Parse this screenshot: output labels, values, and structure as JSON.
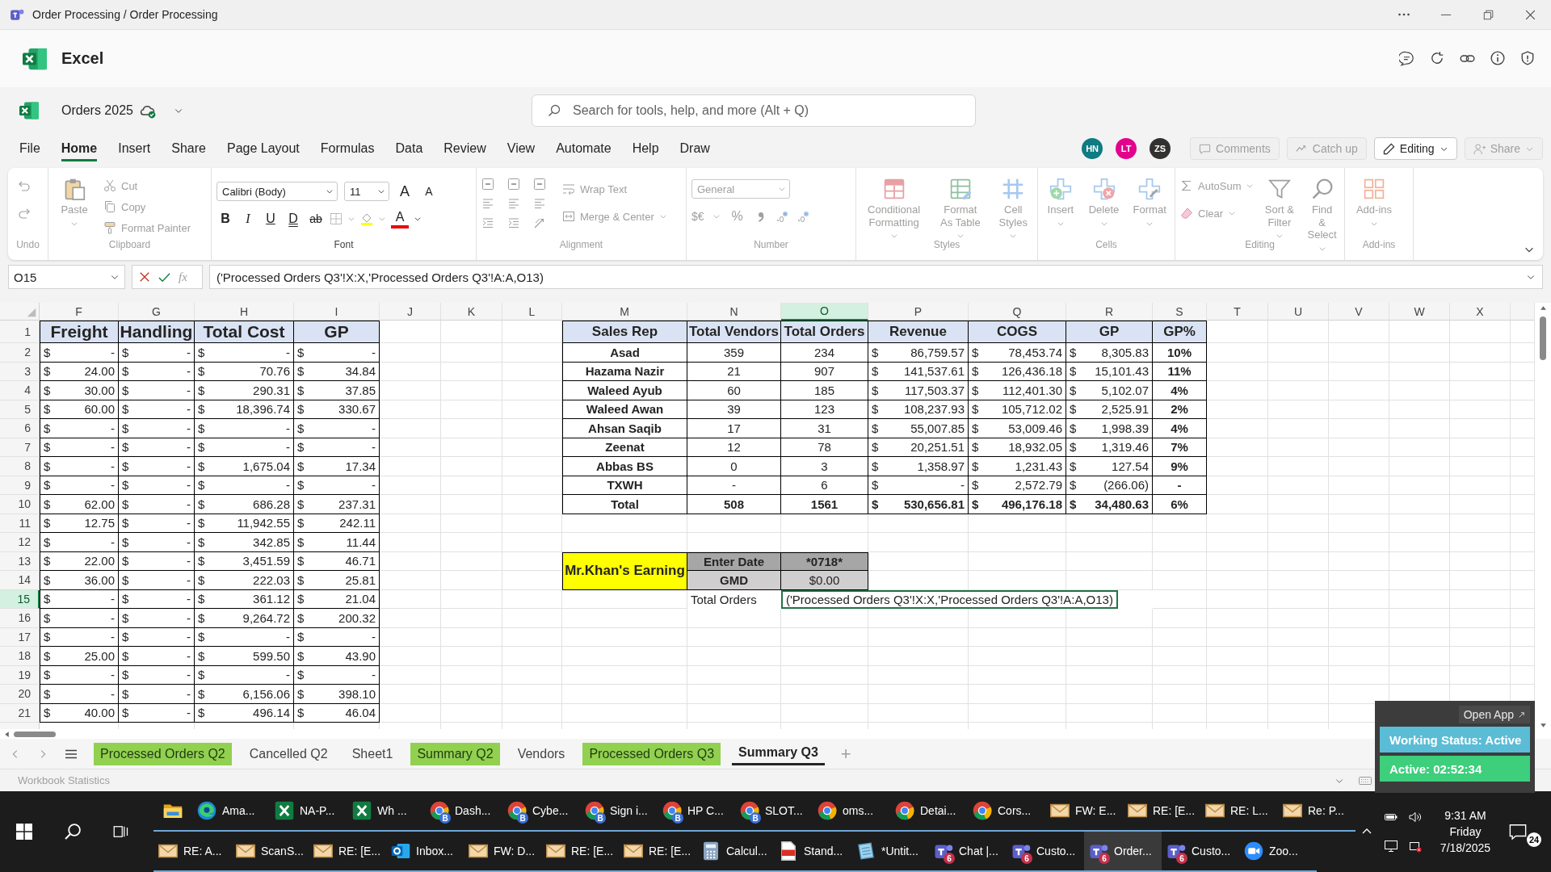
{
  "title_bar": {
    "title": "Order Processing / Order Processing"
  },
  "app": {
    "name": "Excel"
  },
  "document": {
    "name": "Orders 2025"
  },
  "search": {
    "placeholder": "Search for tools, help, and more (Alt + Q)"
  },
  "menu_tabs": [
    {
      "label": "File",
      "selected": false
    },
    {
      "label": "Home",
      "selected": true
    },
    {
      "label": "Insert",
      "selected": false
    },
    {
      "label": "Share",
      "selected": false
    },
    {
      "label": "Page Layout",
      "selected": false
    },
    {
      "label": "Formulas",
      "selected": false
    },
    {
      "label": "Data",
      "selected": false
    },
    {
      "label": "Review",
      "selected": false
    },
    {
      "label": "View",
      "selected": false
    },
    {
      "label": "Automate",
      "selected": false
    },
    {
      "label": "Help",
      "selected": false
    },
    {
      "label": "Draw",
      "selected": false
    }
  ],
  "collaborators": [
    {
      "initials": "HN",
      "color": "#0f7b83"
    },
    {
      "initials": "LT",
      "color": "#e3008c"
    },
    {
      "initials": "ZS",
      "color": "#323130"
    }
  ],
  "header_buttons": [
    {
      "label": "Comments",
      "kind": "comments",
      "disabled": true
    },
    {
      "label": "Catch up",
      "kind": "catchup",
      "disabled": true
    },
    {
      "label": "Editing",
      "kind": "editing",
      "disabled": false
    },
    {
      "label": "Share",
      "kind": "share",
      "disabled": true
    }
  ],
  "ribbon": {
    "groups": [
      {
        "kind": "undo",
        "label": "Undo",
        "disabled": true
      },
      {
        "kind": "clipboard",
        "label": "Clipboard",
        "disabled": true,
        "items": [
          {
            "label": "Paste"
          },
          {
            "label": "Cut"
          },
          {
            "label": "Copy"
          },
          {
            "label": "Format Painter"
          }
        ]
      },
      {
        "kind": "font",
        "label": "Font",
        "disabled": false,
        "items": [
          {
            "label": "Calibri (Body)"
          },
          {
            "label": "11"
          },
          {
            "label": "A"
          },
          {
            "label": "A"
          },
          {
            "label": "B"
          },
          {
            "label": "I"
          },
          {
            "label": "U"
          },
          {
            "label": "D"
          },
          {
            "label": "ab"
          },
          {
            "label": "A"
          }
        ]
      },
      {
        "kind": "alignment",
        "label": "Alignment",
        "disabled": true,
        "items": [
          {
            "label": "Wrap Text"
          },
          {
            "label": "Merge & Center"
          }
        ]
      },
      {
        "kind": "number",
        "label": "Number",
        "disabled": true,
        "items": [
          {
            "label": "General"
          },
          {
            "label": "$€"
          },
          {
            "label": "%"
          }
        ]
      },
      {
        "kind": "styles",
        "label": "Styles",
        "disabled": true,
        "items": [
          {
            "label": "Conditional Formatting"
          },
          {
            "label": "Format As Table"
          },
          {
            "label": "Cell Styles"
          }
        ]
      },
      {
        "kind": "cells",
        "label": "Cells",
        "disabled": true,
        "items": [
          {
            "label": "Insert"
          },
          {
            "label": "Delete"
          },
          {
            "label": "Format"
          }
        ]
      },
      {
        "kind": "editing",
        "label": "Editing",
        "disabled": true,
        "items": [
          {
            "label": "AutoSum"
          },
          {
            "label": "Clear"
          },
          {
            "label": "Sort & Filter"
          },
          {
            "label": "Find & Select"
          }
        ]
      },
      {
        "kind": "addins",
        "label": "Add-ins",
        "disabled": true,
        "items": [
          {
            "label": "Add-ins"
          }
        ]
      }
    ]
  },
  "formula_bar": {
    "name_box": "O15",
    "function_label": "fx",
    "formula": "('Processed Orders Q3'!X:X,'Processed Orders Q3'!A:A,O13)"
  },
  "sheet": {
    "columns": [
      {
        "label": "F",
        "selected": false
      },
      {
        "label": "G",
        "selected": false
      },
      {
        "label": "H",
        "selected": false
      },
      {
        "label": "I",
        "selected": false
      },
      {
        "label": "J",
        "selected": false
      },
      {
        "label": "K",
        "selected": false
      },
      {
        "label": "L",
        "selected": false
      },
      {
        "label": "M",
        "selected": false
      },
      {
        "label": "N",
        "selected": false
      },
      {
        "label": "O",
        "selected": true
      },
      {
        "label": "P",
        "selected": false
      },
      {
        "label": "Q",
        "selected": false
      },
      {
        "label": "R",
        "selected": false
      },
      {
        "label": "S",
        "selected": false
      },
      {
        "label": "T",
        "selected": false
      },
      {
        "label": "U",
        "selected": false
      },
      {
        "label": "V",
        "selected": false
      },
      {
        "label": "W",
        "selected": false
      },
      {
        "label": "X",
        "selected": false
      }
    ],
    "rows": [
      {
        "number": "1",
        "selected": false
      },
      {
        "number": "2",
        "selected": false
      },
      {
        "number": "3",
        "selected": false
      },
      {
        "number": "4",
        "selected": false
      },
      {
        "number": "5",
        "selected": false
      },
      {
        "number": "6",
        "selected": false
      },
      {
        "number": "7",
        "selected": false
      },
      {
        "number": "8",
        "selected": false
      },
      {
        "number": "9",
        "selected": false
      },
      {
        "number": "10",
        "selected": false
      },
      {
        "number": "11",
        "selected": false
      },
      {
        "number": "12",
        "selected": false
      },
      {
        "number": "13",
        "selected": false
      },
      {
        "number": "14",
        "selected": false
      },
      {
        "number": "15",
        "selected": true
      },
      {
        "number": "16",
        "selected": false
      },
      {
        "number": "17",
        "selected": false
      },
      {
        "number": "18",
        "selected": false
      },
      {
        "number": "19",
        "selected": false
      },
      {
        "number": "20",
        "selected": false
      },
      {
        "number": "21",
        "selected": false
      }
    ],
    "left_table": {
      "headers": [
        "Freight",
        "Handling",
        "Total Cost",
        "GP"
      ],
      "rows": [
        [
          [
            "$",
            "-"
          ],
          [
            "$",
            "-"
          ],
          [
            "$",
            "-"
          ],
          [
            "$",
            "-"
          ]
        ],
        [
          [
            "$",
            "24.00"
          ],
          [
            "$",
            "-"
          ],
          [
            "$",
            "70.76"
          ],
          [
            "$",
            "34.84"
          ]
        ],
        [
          [
            "$",
            "30.00"
          ],
          [
            "$",
            "-"
          ],
          [
            "$",
            "290.31"
          ],
          [
            "$",
            "37.85"
          ]
        ],
        [
          [
            "$",
            "60.00"
          ],
          [
            "$",
            "-"
          ],
          [
            "$",
            "18,396.74"
          ],
          [
            "$",
            "330.67"
          ]
        ],
        [
          [
            "$",
            "-"
          ],
          [
            "$",
            "-"
          ],
          [
            "$",
            "-"
          ],
          [
            "$",
            "-"
          ]
        ],
        [
          [
            "$",
            "-"
          ],
          [
            "$",
            "-"
          ],
          [
            "$",
            "-"
          ],
          [
            "$",
            "-"
          ]
        ],
        [
          [
            "$",
            "-"
          ],
          [
            "$",
            "-"
          ],
          [
            "$",
            "1,675.04"
          ],
          [
            "$",
            "17.34"
          ]
        ],
        [
          [
            "$",
            "-"
          ],
          [
            "$",
            "-"
          ],
          [
            "$",
            "-"
          ],
          [
            "$",
            "-"
          ]
        ],
        [
          [
            "$",
            "62.00"
          ],
          [
            "$",
            "-"
          ],
          [
            "$",
            "686.28"
          ],
          [
            "$",
            "237.31"
          ]
        ],
        [
          [
            "$",
            "12.75"
          ],
          [
            "$",
            "-"
          ],
          [
            "$",
            "11,942.55"
          ],
          [
            "$",
            "242.11"
          ]
        ],
        [
          [
            "$",
            "-"
          ],
          [
            "$",
            "-"
          ],
          [
            "$",
            "342.85"
          ],
          [
            "$",
            "11.44"
          ]
        ],
        [
          [
            "$",
            "22.00"
          ],
          [
            "$",
            "-"
          ],
          [
            "$",
            "3,451.59"
          ],
          [
            "$",
            "46.71"
          ]
        ],
        [
          [
            "$",
            "36.00"
          ],
          [
            "$",
            "-"
          ],
          [
            "$",
            "222.03"
          ],
          [
            "$",
            "25.81"
          ]
        ],
        [
          [
            "$",
            "-"
          ],
          [
            "$",
            "-"
          ],
          [
            "$",
            "361.12"
          ],
          [
            "$",
            "21.04"
          ]
        ],
        [
          [
            "$",
            "-"
          ],
          [
            "$",
            "-"
          ],
          [
            "$",
            "9,264.72"
          ],
          [
            "$",
            "200.32"
          ]
        ],
        [
          [
            "$",
            "-"
          ],
          [
            "$",
            "-"
          ],
          [
            "$",
            "-"
          ],
          [
            "$",
            "-"
          ]
        ],
        [
          [
            "$",
            "25.00"
          ],
          [
            "$",
            "-"
          ],
          [
            "$",
            "599.50"
          ],
          [
            "$",
            "43.90"
          ]
        ],
        [
          [
            "$",
            "-"
          ],
          [
            "$",
            "-"
          ],
          [
            "$",
            "-"
          ],
          [
            "$",
            "-"
          ]
        ],
        [
          [
            "$",
            "-"
          ],
          [
            "$",
            "-"
          ],
          [
            "$",
            "6,156.06"
          ],
          [
            "$",
            "398.10"
          ]
        ],
        [
          [
            "$",
            "40.00"
          ],
          [
            "$",
            "-"
          ],
          [
            "$",
            "496.14"
          ],
          [
            "$",
            "46.04"
          ]
        ]
      ]
    },
    "summary_table": {
      "headers": [
        "Sales Rep",
        "Total Vendors",
        "Total Orders",
        "Revenue",
        "COGS",
        "GP",
        "GP%"
      ],
      "rows": [
        {
          "kind": "rep",
          "sales_rep": "Asad",
          "total_vendors": "359",
          "total_orders": "234",
          "revenue": [
            "$",
            "86,759.57"
          ],
          "cogs": [
            "$",
            "78,453.74"
          ],
          "gp": [
            "$",
            "8,305.83"
          ],
          "gp_pct": "10%"
        },
        {
          "kind": "rep",
          "sales_rep": "Hazama Nazir",
          "total_vendors": "21",
          "total_orders": "907",
          "revenue": [
            "$",
            "141,537.61"
          ],
          "cogs": [
            "$",
            "126,436.18"
          ],
          "gp": [
            "$",
            "15,101.43"
          ],
          "gp_pct": "11%"
        },
        {
          "kind": "rep",
          "sales_rep": "Waleed Ayub",
          "total_vendors": "60",
          "total_orders": "185",
          "revenue": [
            "$",
            "117,503.37"
          ],
          "cogs": [
            "$",
            "112,401.30"
          ],
          "gp": [
            "$",
            "5,102.07"
          ],
          "gp_pct": "4%"
        },
        {
          "kind": "rep",
          "sales_rep": "Waleed Awan",
          "total_vendors": "39",
          "total_orders": "123",
          "revenue": [
            "$",
            "108,237.93"
          ],
          "cogs": [
            "$",
            "105,712.02"
          ],
          "gp": [
            "$",
            "2,525.91"
          ],
          "gp_pct": "2%"
        },
        {
          "kind": "rep",
          "sales_rep": "Ahsan Saqib",
          "total_vendors": "17",
          "total_orders": "31",
          "revenue": [
            "$",
            "55,007.85"
          ],
          "cogs": [
            "$",
            "53,009.46"
          ],
          "gp": [
            "$",
            "1,998.39"
          ],
          "gp_pct": "4%"
        },
        {
          "kind": "rep",
          "sales_rep": "Zeenat",
          "total_vendors": "12",
          "total_orders": "78",
          "revenue": [
            "$",
            "20,251.51"
          ],
          "cogs": [
            "$",
            "18,932.05"
          ],
          "gp": [
            "$",
            "1,319.46"
          ],
          "gp_pct": "7%"
        },
        {
          "kind": "rep",
          "sales_rep": "Abbas BS",
          "total_vendors": "0",
          "total_orders": "3",
          "revenue": [
            "$",
            "1,358.97"
          ],
          "cogs": [
            "$",
            "1,231.43"
          ],
          "gp": [
            "$",
            "127.54"
          ],
          "gp_pct": "9%"
        },
        {
          "kind": "rep",
          "sales_rep": "TXWH",
          "total_vendors": "-",
          "total_orders": "6",
          "revenue": [
            "$",
            "-"
          ],
          "cogs": [
            "$",
            "2,572.79"
          ],
          "gp": [
            "$",
            "(266.06)"
          ],
          "gp_pct": "-"
        },
        {
          "kind": "total",
          "sales_rep": "Total",
          "total_vendors": "508",
          "total_orders": "1561",
          "revenue": [
            "$",
            "530,656.81"
          ],
          "cogs": [
            "$",
            "496,176.18"
          ],
          "gp": [
            "$",
            "34,480.63"
          ],
          "gp_pct": "6%"
        }
      ]
    },
    "earnings": {
      "title": "Mr.Khan's Earning",
      "rows": [
        {
          "label": "Enter Date",
          "value": "*0718*"
        },
        {
          "label": "GMD",
          "value": "$0.00"
        }
      ]
    },
    "total_orders": {
      "label": "Total Orders",
      "formula": "('Processed Orders Q3'!X:X,'Processed Orders Q3'!A:A,O13)"
    }
  },
  "sheet_tabs": [
    {
      "label": "Processed Orders Q2",
      "color": "#92d050",
      "selected": false
    },
    {
      "label": "Cancelled Q2",
      "selected": false
    },
    {
      "label": "Sheet1",
      "selected": false
    },
    {
      "label": "Summary Q2",
      "color": "#92d050",
      "selected": false
    },
    {
      "label": "Vendors",
      "selected": false
    },
    {
      "label": "Processed Orders Q3",
      "color": "#92d050",
      "selected": false
    },
    {
      "label": "Summary Q3",
      "selected": true
    }
  ],
  "add_sheet": "+",
  "status_bar": {
    "label": "Workbook Statistics"
  },
  "widget": {
    "open_app": "Open App",
    "status": "Working Status: Active",
    "timer": "Active: 02:52:34"
  },
  "taskbar": {
    "rows": [
      [
        {
          "kind": "folder",
          "selected": false
        },
        {
          "kind": "edge",
          "label": "Ama...",
          "selected": false
        },
        {
          "kind": "excel",
          "label": "NA-P...",
          "selected": false
        },
        {
          "kind": "excel",
          "label": "Wh ...",
          "selected": false
        },
        {
          "kind": "chrome",
          "label": "Dash...",
          "badge": "B",
          "selected": false
        },
        {
          "kind": "chrome",
          "label": "Cybe...",
          "badge": "B",
          "selected": false
        },
        {
          "kind": "chrome",
          "label": "Sign i...",
          "badge": "B",
          "selected": false
        },
        {
          "kind": "chrome",
          "label": "HP C...",
          "badge": "B",
          "selected": false
        },
        {
          "kind": "chrome",
          "label": "SLOT...",
          "badge": "B",
          "selected": false
        },
        {
          "kind": "chrome",
          "label": "oms...",
          "selected": false
        },
        {
          "kind": "chrome",
          "label": "Detai...",
          "selected": false
        },
        {
          "kind": "chrome",
          "label": "Cors...",
          "selected": false
        },
        {
          "kind": "mail",
          "label": "FW: E...",
          "selected": false
        },
        {
          "kind": "mail",
          "label": "RE: [E...",
          "selected": false
        },
        {
          "kind": "mail",
          "label": "RE: L...",
          "selected": false
        },
        {
          "kind": "mail",
          "label": "Re: P...",
          "selected": false
        }
      ],
      [
        {
          "kind": "mail",
          "label": "RE: A...",
          "selected": false
        },
        {
          "kind": "mail",
          "label": "ScanS...",
          "selected": false
        },
        {
          "kind": "mail",
          "label": "RE: [E...",
          "selected": false
        },
        {
          "kind": "outlook",
          "label": "Inbox...",
          "selected": false
        },
        {
          "kind": "mail",
          "label": "FW: D...",
          "selected": false
        },
        {
          "kind": "mail",
          "label": "RE: [E...",
          "selected": false
        },
        {
          "kind": "mail",
          "label": "RE: [E...",
          "selected": false
        },
        {
          "kind": "calculator",
          "label": "Calcul...",
          "selected": false
        },
        {
          "kind": "pdf",
          "label": "Stand...",
          "selected": false
        },
        {
          "kind": "notepad",
          "label": "*Untit...",
          "selected": false
        },
        {
          "kind": "teams",
          "label": "Chat |...",
          "badge": "6",
          "selected": false
        },
        {
          "kind": "teams",
          "label": "Custo...",
          "badge": "6",
          "selected": false
        },
        {
          "kind": "teams",
          "label": "Order...",
          "badge": "6",
          "selected": true
        },
        {
          "kind": "teams",
          "label": "Custo...",
          "badge": "6",
          "selected": false
        },
        {
          "kind": "zoom",
          "label": "Zoo...",
          "selected": false
        }
      ]
    ],
    "clock": {
      "time": "9:31 AM",
      "day": "Friday",
      "date": "7/18/2025"
    },
    "notifications": {
      "count": "24"
    }
  }
}
